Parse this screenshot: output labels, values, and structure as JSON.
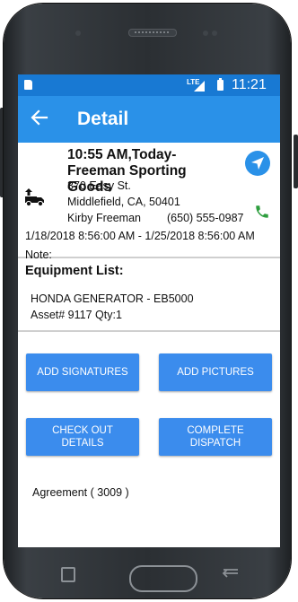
{
  "status_bar": {
    "network": "LTE",
    "time": "11:21"
  },
  "app_bar": {
    "back_icon": "arrow-left-icon",
    "title": "Detail"
  },
  "dispatch": {
    "heading": "10:55 AM,Today-Freeman Sporting Goods",
    "address_line1": "370 Easy St.",
    "address_line2": "Middlefield, CA, 50401",
    "contact_name": "Kirby Freeman",
    "contact_phone": "(650) 555-0987",
    "date_range": "1/18/2018 8:56:00 AM  -  1/25/2018 8:56:00 AM",
    "note_label": "Note:",
    "type_icon": "delivery-truck-icon",
    "navigate_icon": "navigation-arrow-icon",
    "call_icon": "phone-icon"
  },
  "equipment": {
    "header": "Equipment List:",
    "items": [
      {
        "name": "HONDA GENERATOR - EB5000",
        "asset": "Asset# 9117  Qty:1"
      }
    ]
  },
  "actions": {
    "add_signatures": "ADD SIGNATURES",
    "add_pictures": "ADD PICTURES",
    "check_out_details": "CHECK OUT DETAILS",
    "complete_dispatch": "COMPLETE DISPATCH"
  },
  "agreement": "Agreement ( 3009 )",
  "colors": {
    "status_bar": "#1879d3",
    "app_bar": "#2a91e8",
    "button": "#3b8ced",
    "call_green": "#2e9e3e"
  }
}
